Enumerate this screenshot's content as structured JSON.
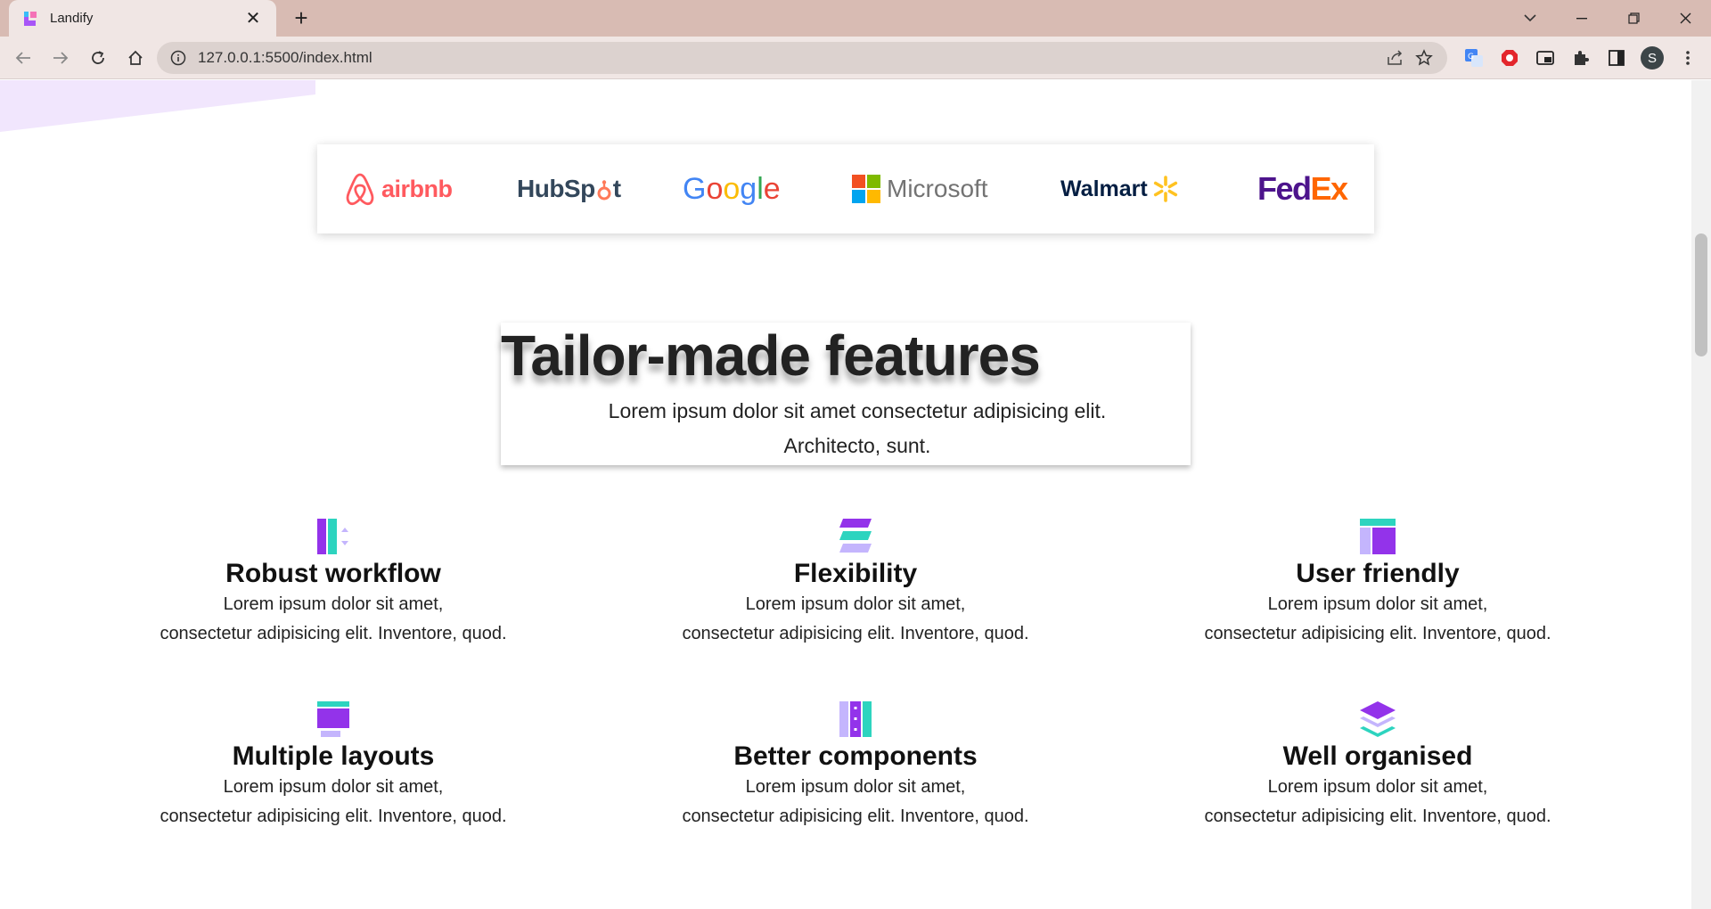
{
  "browser": {
    "tab_title": "Landify",
    "url": "127.0.0.1:5500/index.html",
    "avatar_letter": "S"
  },
  "logos": {
    "airbnb": "airbnb",
    "hubspot_a": "HubSp",
    "hubspot_b": "t",
    "google": [
      "G",
      "o",
      "o",
      "g",
      "l",
      "e"
    ],
    "microsoft": "Microsoft",
    "walmart": "Walmart",
    "fedex_a": "Fed",
    "fedex_b": "Ex"
  },
  "features_section": {
    "title": "Tailor-made features",
    "subtitle_line1": "Lorem ipsum dolor sit amet consectetur adipisicing elit.",
    "subtitle_line2": "Architecto, sunt."
  },
  "features": [
    {
      "name": "Robust workflow",
      "line1": "Lorem ipsum dolor sit amet,",
      "line2": "consectetur adipisicing elit. Inventore, quod.",
      "icon": "workflow-icon"
    },
    {
      "name": "Flexibility",
      "line1": "Lorem ipsum dolor sit amet,",
      "line2": "consectetur adipisicing elit. Inventore, quod.",
      "icon": "flexibility-icon"
    },
    {
      "name": "User friendly",
      "line1": "Lorem ipsum dolor sit amet,",
      "line2": "consectetur adipisicing elit. Inventore, quod.",
      "icon": "user-friendly-icon"
    },
    {
      "name": "Multiple layouts",
      "line1": "Lorem ipsum dolor sit amet,",
      "line2": "consectetur adipisicing elit. Inventore, quod.",
      "icon": "layouts-icon"
    },
    {
      "name": "Better components",
      "line1": "Lorem ipsum dolor sit amet,",
      "line2": "consectetur adipisicing elit. Inventore, quod.",
      "icon": "components-icon"
    },
    {
      "name": "Well organised",
      "line1": "Lorem ipsum dolor sit amet,",
      "line2": "consectetur adipisicing elit. Inventore, quod.",
      "icon": "layers-icon"
    }
  ],
  "colors": {
    "accent_purple": "#9333ea",
    "accent_teal": "#2dd4bf",
    "light_purple": "#c4b5fd",
    "chrome_tab_bar": "#d8bbb3"
  }
}
